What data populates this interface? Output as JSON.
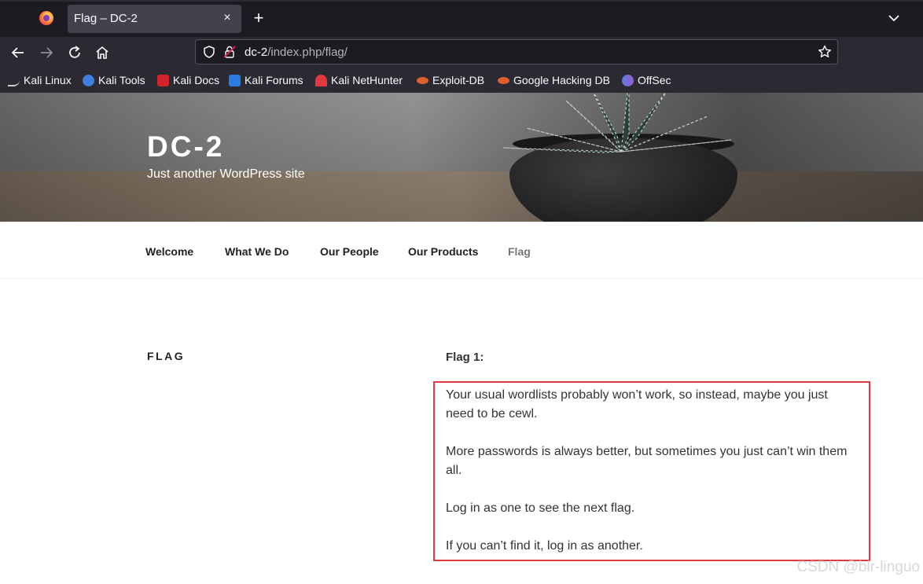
{
  "browser": {
    "tab_title": "Flag – DC-2",
    "tab_close_label": "×",
    "new_tab_label": "+",
    "url_host": "dc-2",
    "url_path": "/index.php/flag/",
    "bookmarks": [
      {
        "label": "Kali Linux",
        "icon": "kali-dragon-icon",
        "color": "#cfcfcf"
      },
      {
        "label": "Kali Tools",
        "icon": "kali-tools-icon",
        "color": "#3f7fe0"
      },
      {
        "label": "Kali Docs",
        "icon": "kali-docs-icon",
        "color": "#d4222a"
      },
      {
        "label": "Kali Forums",
        "icon": "kali-forums-icon",
        "color": "#2a7de1"
      },
      {
        "label": "Kali NetHunter",
        "icon": "nethunter-icon",
        "color": "#e0393e"
      },
      {
        "label": "Exploit-DB",
        "icon": "exploit-db-icon",
        "color": "#e0602b"
      },
      {
        "label": "Google Hacking DB",
        "icon": "ghdb-icon",
        "color": "#e0602b"
      },
      {
        "label": "OffSec",
        "icon": "offsec-icon",
        "color": "#5b7fe0"
      }
    ]
  },
  "site": {
    "title": "DC-2",
    "description": "Just another WordPress site",
    "menu": [
      {
        "label": "Welcome",
        "current": false
      },
      {
        "label": "What We Do",
        "current": false
      },
      {
        "label": "Our People",
        "current": false
      },
      {
        "label": "Our Products",
        "current": false
      },
      {
        "label": "Flag",
        "current": true
      }
    ]
  },
  "page": {
    "entry_title": "FLAG",
    "flag_heading": "Flag 1:",
    "paragraphs": [
      "Your usual wordlists probably won’t work, so instead, maybe you just need to be cewl.",
      "More passwords is always better, but sometimes you just can’t win them all.",
      "Log in as one to see the next flag.",
      "If you can’t find it, log in as another."
    ]
  },
  "watermark": "CSDN @blr-linguo",
  "colors": {
    "chrome_dark": "#1c1b22",
    "chrome_mid": "#2b2a33",
    "highlight_border": "#e0393e"
  }
}
